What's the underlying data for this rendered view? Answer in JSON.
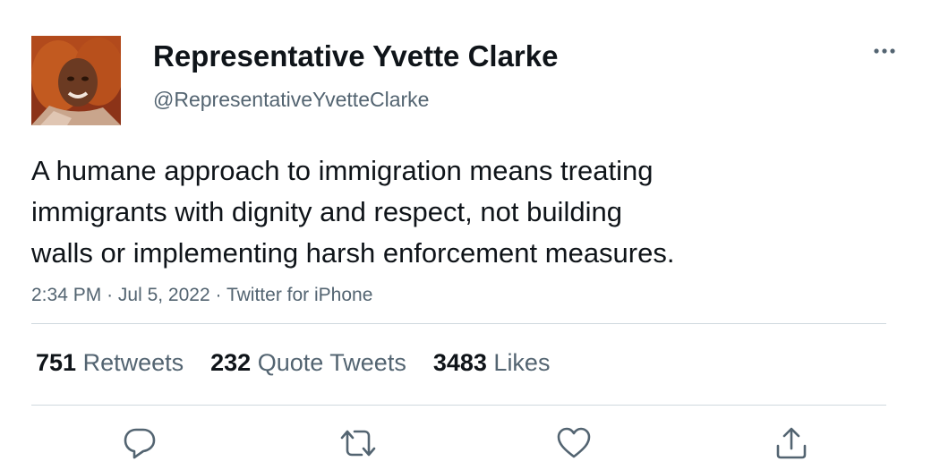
{
  "author": {
    "display_name": "Representative Yvette Clarke",
    "handle": "@RepresentativeYvetteClarke",
    "avatar_icon": "profile-photo"
  },
  "more_icon": "more-horizontal-icon",
  "tweet": {
    "lines": [
      "A humane approach to immigration means treating",
      "immigrants with dignity and respect, not building",
      "walls or implementing harsh enforcement measures."
    ],
    "time": "2:34 PM",
    "separator": "·",
    "date": "Jul 5, 2022",
    "source": "Twitter for iPhone"
  },
  "stats": {
    "retweets": {
      "count": "751",
      "label": "Retweets"
    },
    "quote_tweets": {
      "count": "232",
      "label": "Quote Tweets"
    },
    "likes": {
      "count": "3483",
      "label": "Likes"
    }
  },
  "actions": [
    {
      "icon": "reply-icon"
    },
    {
      "icon": "retweet-icon"
    },
    {
      "icon": "like-icon"
    },
    {
      "icon": "share-icon"
    }
  ],
  "colors": {
    "text_primary": "#0f1419",
    "text_secondary": "#536471",
    "divider": "#cfd9de"
  }
}
